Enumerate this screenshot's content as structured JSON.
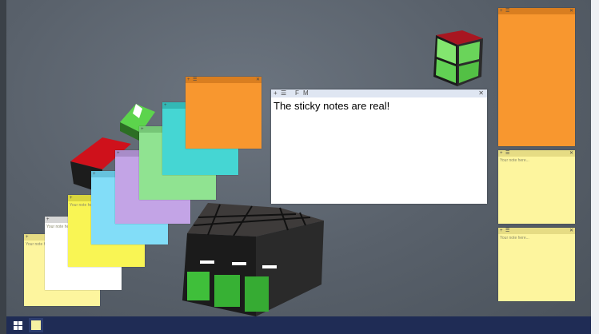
{
  "main_note": {
    "text": "The sticky notes are real!",
    "toolbar": {
      "add": "+",
      "list": "☰",
      "font": "F",
      "more": "M",
      "close": "✕"
    }
  },
  "note_placeholder": "Your note here...",
  "note_toolbar": {
    "add": "+",
    "list": "☰",
    "font": "F",
    "more": "M",
    "close": "✕"
  },
  "notes_colors": {
    "yellow_light": "#fdf59e",
    "white": "#ffffff",
    "yellow": "#f9f554",
    "blue": "#82ddf8",
    "purple": "#c3a4e6",
    "green": "#90e391",
    "cyan": "#45d6d3",
    "orange": "#f8972f"
  },
  "taskbar": {
    "start_icon": "windows-logo-icon",
    "app_icon": "sticky-notes-icon"
  }
}
